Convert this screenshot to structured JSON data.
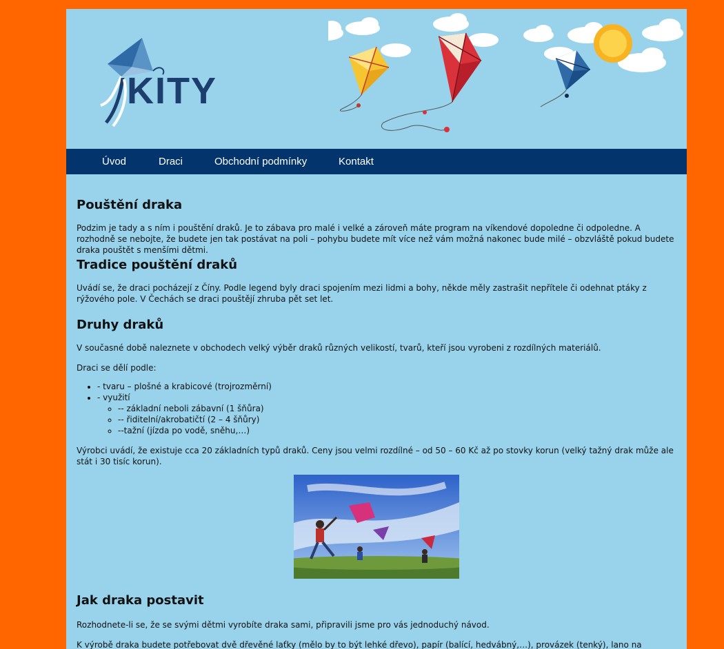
{
  "brand": {
    "logo_text": "KITY"
  },
  "nav": {
    "items": [
      {
        "label": "Úvod"
      },
      {
        "label": "Draci"
      },
      {
        "label": "Obchodní podmínky"
      },
      {
        "label": "Kontakt"
      }
    ]
  },
  "sections": {
    "s1": {
      "heading": "Pouštění draka",
      "text": "Podzim je tady a s ním i pouštění draků. Je to zábava pro malé i velké a zároveň máte program na víkendové dopoledne či odpoledne. A rozhodně se nebojte, že budete jen tak postávat na poli – pohybu budete mít více než vám možná nakonec bude milé – obzvláště pokud budete draka pouštět s menšími dětmi."
    },
    "s2": {
      "heading": "Tradice pouštění draků",
      "text": "Uvádí se, že draci pocházejí z Číny. Podle legend byly draci spojením mezi lidmi a bohy, někde měly zastrašit nepřítele či odehnat ptáky z rýžového pole. V Čechách se draci pouštějí zhruba pět set let."
    },
    "s3": {
      "heading": "Druhy draků",
      "text1": "V současné době naleznete v obchodech velký výběr draků různých velikostí, tvarů, kteří jsou vyrobeni z rozdílných materiálů.",
      "text2": "Draci se dělí podle:",
      "list": {
        "item1": "- tvaru – plošné a krabicové (trojrozměrní)",
        "item2": "- využití",
        "sub1": "-- základní neboli zábavní (1 šňůra)",
        "sub2": "-- řiditelní/akrobatičtí (2 – 4 šňůry)",
        "sub3": "--tažní (jízda po vodě, sněhu,…)"
      },
      "text3": "Výrobci uvádí, že existuje cca 20 základních typů draků. Ceny jsou velmi rozdílné – od 50 – 60 Kč až po stovky korun (velký tažný drak může ale stát i 30 tisíc korun)."
    },
    "s4": {
      "heading": "Jak draka postavit",
      "text1": "Rozhodnete-li se, že se svými dětmi vyrobíte draka sami, připravili jsme pro vás jednoduchý návod.",
      "text2": "K výrobě draka budete potřebovat dvě dřevěné laťky (mělo by to být lehké dřevo), papír (balící, hedvábný,…), provázek (tenký), lano na pouštění draka"
    }
  },
  "colors": {
    "page_bg": "#ff6600",
    "content_bg": "#98d3eb",
    "nav_bg": "#03346b",
    "logo": "#1b3e6e"
  }
}
